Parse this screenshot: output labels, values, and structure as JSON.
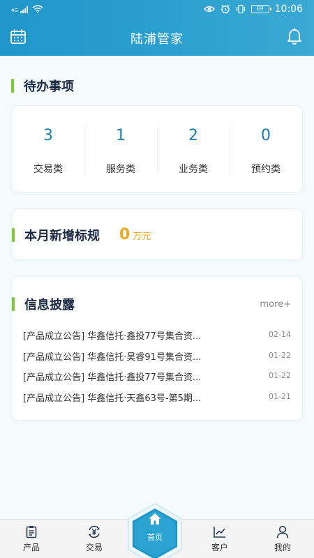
{
  "status_bar": {
    "network": "4G",
    "battery": "69",
    "time": "10:06"
  },
  "header": {
    "title": "陆浦管家",
    "left_icon": "calendar-icon",
    "right_icon": "bell-icon"
  },
  "todo": {
    "title": "待办事项",
    "items": [
      {
        "count": "3",
        "label": "交易类"
      },
      {
        "count": "1",
        "label": "服务类"
      },
      {
        "count": "2",
        "label": "业务类"
      },
      {
        "count": "0",
        "label": "预约类"
      }
    ]
  },
  "monthly": {
    "title": "本月新增标规",
    "value": "0",
    "unit": "万元"
  },
  "disclosure": {
    "title": "信息披露",
    "more": "more+",
    "items": [
      {
        "title": "[产品成立公告] 华鑫信托·鑫投77号集合资...",
        "date": "02-14"
      },
      {
        "title": "[产品成立公告] 华鑫信托·昊睿91号集合资...",
        "date": "01-22"
      },
      {
        "title": "[产品成立公告] 华鑫信托·鑫投77号集合资...",
        "date": "01-22"
      },
      {
        "title": "[产品成立公告] 华鑫信托·天鑫63号-第5期...",
        "date": "01-21"
      }
    ]
  },
  "tabbar": {
    "tabs": [
      {
        "label": "产品",
        "icon": "clipboard-icon"
      },
      {
        "label": "交易",
        "icon": "yuan-cycle-icon"
      },
      {
        "label": "首页",
        "icon": "home-icon"
      },
      {
        "label": "客户",
        "icon": "chart-line-icon"
      },
      {
        "label": "我的",
        "icon": "person-icon"
      }
    ]
  },
  "colors": {
    "header": "#2a9fcf",
    "accent_green": "#7dc93b",
    "count_blue": "#1c7fb0",
    "value_orange": "#f0a81c"
  }
}
